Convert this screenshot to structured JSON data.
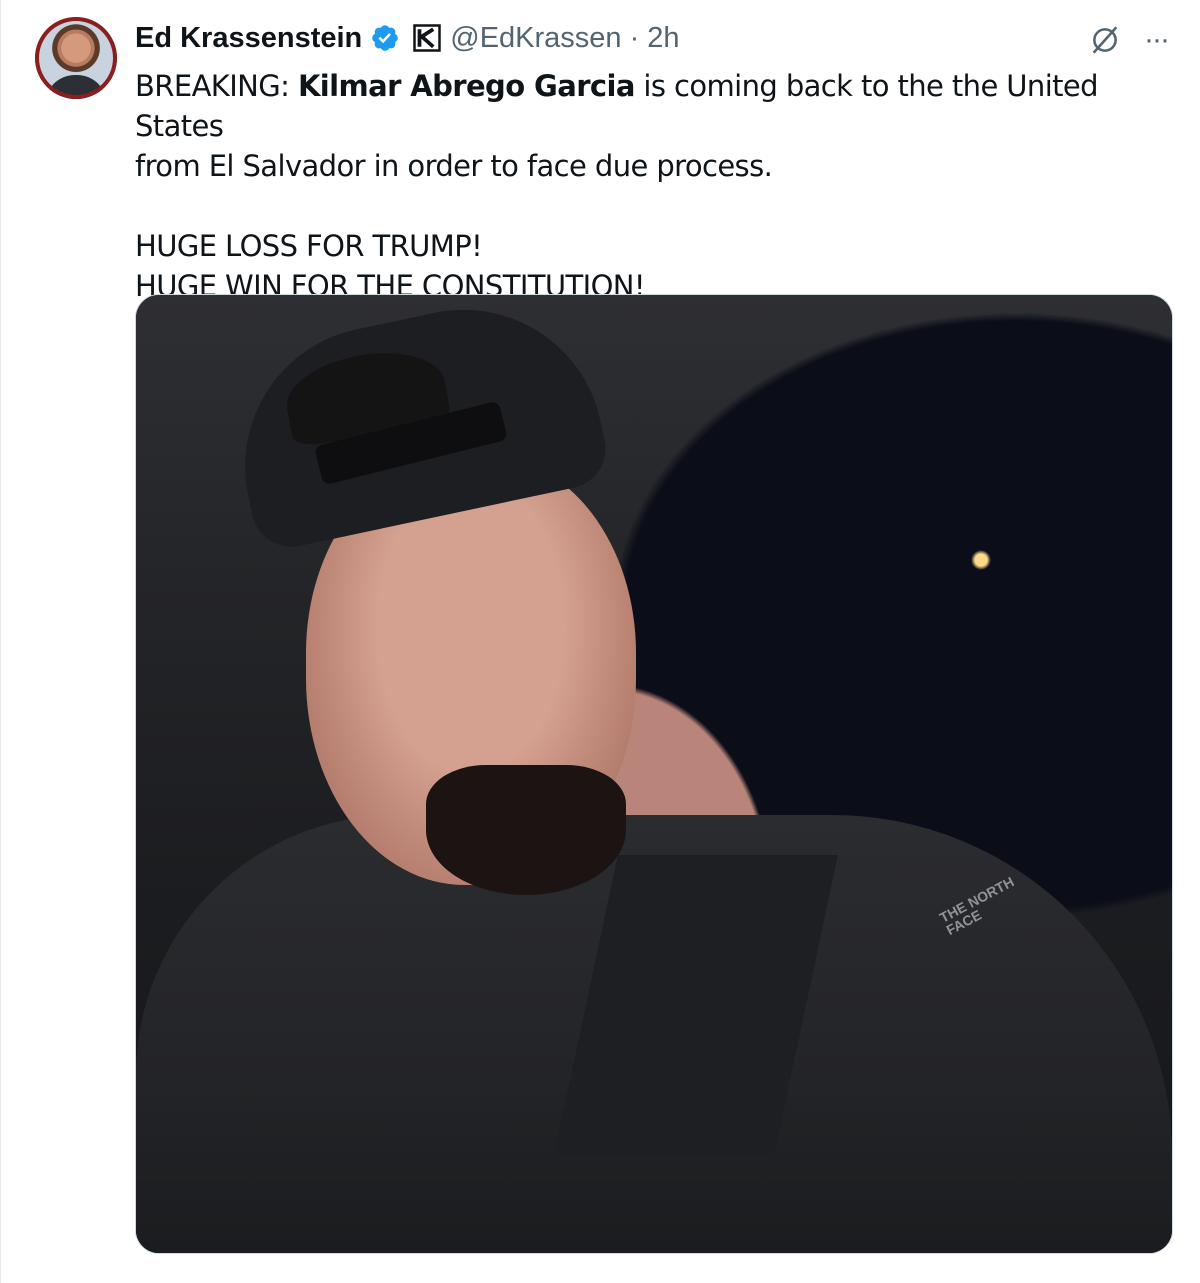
{
  "author": {
    "display_name": "Ed Krassenstein",
    "handle": "@EdKrassen",
    "separator": "·",
    "time": "2h"
  },
  "tweet": {
    "line1_prefix": "BREAKING: ",
    "line1_bold": "Kilmar Abrego Garcia",
    "line1_suffix": " is coming back to the the United States",
    "line2": "from El Salvador in order to face due process.",
    "line3": "HUGE LOSS FOR TRUMP!",
    "line4": "HUGE WIN FOR THE CONSTITUTION!"
  },
  "media": {
    "jacket_logo": "THE NORTH FACE"
  },
  "colors": {
    "verified": "#1d9bf0",
    "secondary_text": "#536471",
    "primary_text": "#0f1419"
  },
  "icons": [
    "verified-badge-icon",
    "affiliate-badge-icon",
    "grok-icon",
    "more-icon"
  ]
}
